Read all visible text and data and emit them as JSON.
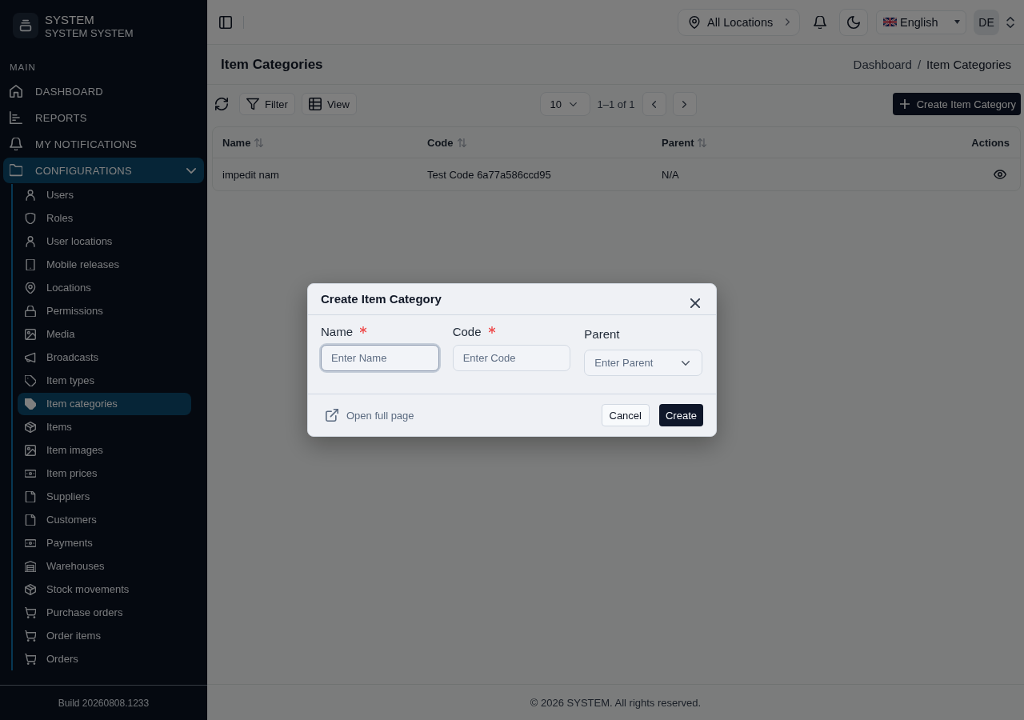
{
  "sidebar": {
    "brand": {
      "title": "SYSTEM",
      "subtitle": "SYSTEM SYSTEM"
    },
    "section_label": "MAIN",
    "items": [
      {
        "label": "DASHBOARD",
        "selected": false
      },
      {
        "label": "REPORTS",
        "selected": false
      },
      {
        "label": "MY NOTIFICATIONS",
        "selected": false
      },
      {
        "label": "CONFIGURATIONS",
        "selected": true,
        "expanded": true,
        "children": [
          {
            "label": "Users",
            "selected": false
          },
          {
            "label": "Roles",
            "selected": false
          },
          {
            "label": "User locations",
            "selected": false
          },
          {
            "label": "Mobile releases",
            "selected": false
          },
          {
            "label": "Locations",
            "selected": false
          },
          {
            "label": "Permissions",
            "selected": false
          },
          {
            "label": "Media",
            "selected": false
          },
          {
            "label": "Broadcasts",
            "selected": false
          },
          {
            "label": "Item types",
            "selected": false
          },
          {
            "label": "Item categories",
            "selected": true
          },
          {
            "label": "Items",
            "selected": false
          },
          {
            "label": "Item images",
            "selected": false
          },
          {
            "label": "Item prices",
            "selected": false
          },
          {
            "label": "Suppliers",
            "selected": false
          },
          {
            "label": "Customers",
            "selected": false
          },
          {
            "label": "Payments",
            "selected": false
          },
          {
            "label": "Warehouses",
            "selected": false
          },
          {
            "label": "Stock movements",
            "selected": false
          },
          {
            "label": "Purchase orders",
            "selected": false
          },
          {
            "label": "Order items",
            "selected": false
          },
          {
            "label": "Orders",
            "selected": false
          }
        ]
      }
    ],
    "build": "Build 20260808.1233"
  },
  "header": {
    "location": "All Locations",
    "language": "English",
    "avatar": "DE"
  },
  "page": {
    "title": "Item Categories",
    "breadcrumb": {
      "items": [
        "Dashboard",
        "Item Categories"
      ],
      "separator": "/"
    }
  },
  "toolbar": {
    "filter": "Filter",
    "view": "View",
    "page_size": "10",
    "range": "1–1 of 1",
    "create": "Create Item Category"
  },
  "table": {
    "columns": [
      {
        "label": "Name",
        "sortable": true
      },
      {
        "label": "Code",
        "sortable": true
      },
      {
        "label": "Parent",
        "sortable": true
      },
      {
        "label": "Actions",
        "sortable": false
      }
    ],
    "rows": [
      {
        "cells": [
          "impedit nam",
          "Test Code 6a77a586ccd95",
          "N/A"
        ]
      }
    ]
  },
  "footer": "© 2026 SYSTEM. All rights reserved.",
  "dialog": {
    "title": "Create Item Category",
    "fields": [
      {
        "kind": "text",
        "label": "Name",
        "required": true,
        "placeholder": "Enter Name",
        "focused": true
      },
      {
        "kind": "text",
        "label": "Code",
        "required": true,
        "placeholder": "Enter Code",
        "focused": false
      },
      {
        "kind": "select",
        "label": "Parent",
        "required": false,
        "placeholder": "Enter Parent",
        "focused": false
      }
    ],
    "open_full_page": "Open full page",
    "buttons": [
      {
        "label": "Cancel",
        "kind": "secondary"
      },
      {
        "label": "Create",
        "kind": "primary"
      }
    ]
  }
}
